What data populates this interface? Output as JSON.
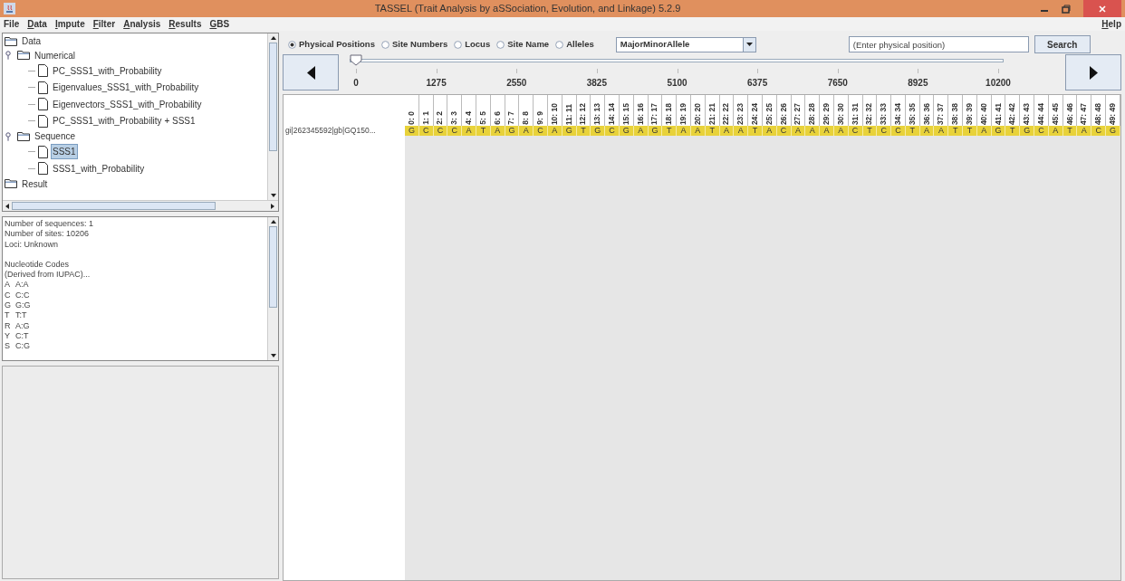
{
  "window": {
    "title": "TASSEL (Trait Analysis by aSSociation, Evolution, and Linkage) 5.2.9"
  },
  "menu": [
    {
      "label": "File",
      "mnemonic": false
    },
    {
      "label": "Data",
      "mnemonic": true
    },
    {
      "label": "Impute",
      "mnemonic": true
    },
    {
      "label": "Filter",
      "mnemonic": true
    },
    {
      "label": "Analysis",
      "mnemonic": true
    },
    {
      "label": "Results",
      "mnemonic": true
    },
    {
      "label": "GBS",
      "mnemonic": true
    }
  ],
  "help_menu": {
    "label": "Help",
    "mnemonic": true
  },
  "tree": [
    {
      "label": "Data",
      "selected": false,
      "children": [
        {
          "label": "Numerical",
          "expanded": true,
          "selected": false,
          "children": [
            {
              "label": "PC_SSS1_with_Probability",
              "selected": false
            },
            {
              "label": "Eigenvalues_SSS1_with_Probability",
              "selected": false
            },
            {
              "label": "Eigenvectors_SSS1_with_Probability",
              "selected": false
            },
            {
              "label": "PC_SSS1_with_Probability + SSS1",
              "selected": false
            }
          ]
        },
        {
          "label": "Sequence",
          "expanded": true,
          "selected": false,
          "children": [
            {
              "label": "SSS1",
              "selected": true
            },
            {
              "label": "SSS1_with_Probability",
              "selected": false
            }
          ]
        }
      ]
    },
    {
      "label": "Result",
      "selected": false
    }
  ],
  "info": {
    "paragraphs": [
      [
        "Number of sequences: 1",
        "Number of sites: 10206",
        "Loci: Unknown"
      ],
      [
        "Nucleotide Codes",
        "(Derived from IUPAC)..."
      ]
    ],
    "codes": [
      {
        "code": "A",
        "meaning": "A:A"
      },
      {
        "code": "C",
        "meaning": "C:C"
      },
      {
        "code": "G",
        "meaning": "G:G"
      },
      {
        "code": "T",
        "meaning": "T:T"
      },
      {
        "code": "R",
        "meaning": "A:G"
      },
      {
        "code": "Y",
        "meaning": "C:T"
      },
      {
        "code": "S",
        "meaning": "C:G"
      }
    ]
  },
  "position_modes": [
    {
      "label": "Physical Positions",
      "selected": true
    },
    {
      "label": "Site Numbers",
      "selected": false
    },
    {
      "label": "Locus",
      "selected": false
    },
    {
      "label": "Site Name",
      "selected": false
    },
    {
      "label": "Alleles",
      "selected": false
    }
  ],
  "display_dropdown": {
    "value": "MajorMinorAllele"
  },
  "search": {
    "placeholder": "(Enter physical position)",
    "button": "Search"
  },
  "slider": {
    "level": 0,
    "ticks": [
      "0",
      "1275",
      "2550",
      "3825",
      "5100",
      "6375",
      "7650",
      "8925",
      "10200"
    ]
  },
  "sites": [
    "0: 0",
    "1: 1",
    "2: 2",
    "3: 3",
    "4: 4",
    "5: 5",
    "6: 6",
    "7: 7",
    "8: 8",
    "9: 9",
    "10: 10",
    "11: 11",
    "12: 12",
    "13: 13",
    "14: 14",
    "15: 15",
    "16: 16",
    "17: 17",
    "18: 18",
    "19: 19",
    "20: 20",
    "21: 21",
    "22: 22",
    "23: 23",
    "24: 24",
    "25: 25",
    "26: 26",
    "27: 27",
    "28: 28",
    "29: 29",
    "30: 30",
    "31: 31",
    "32: 32",
    "33: 33",
    "34: 34",
    "35: 35",
    "36: 36",
    "37: 37",
    "38: 38",
    "39: 39",
    "40: 40",
    "41: 41",
    "42: 42",
    "43: 43",
    "44: 44",
    "45: 45",
    "46: 46",
    "47: 47",
    "48: 48",
    "49: 49"
  ],
  "taxa": [
    {
      "name": "gi|262345592|gb|GQ150...",
      "bases": [
        "G",
        "C",
        "C",
        "C",
        "A",
        "T",
        "A",
        "G",
        "A",
        "C",
        "A",
        "G",
        "T",
        "G",
        "C",
        "G",
        "A",
        "G",
        "T",
        "A",
        "A",
        "T",
        "A",
        "A",
        "T",
        "A",
        "C",
        "A",
        "A",
        "A",
        "A",
        "C",
        "T",
        "C",
        "C",
        "T",
        "A",
        "A",
        "T",
        "T",
        "A",
        "G",
        "T",
        "G",
        "C",
        "A",
        "T",
        "A",
        "C",
        "G"
      ]
    }
  ]
}
